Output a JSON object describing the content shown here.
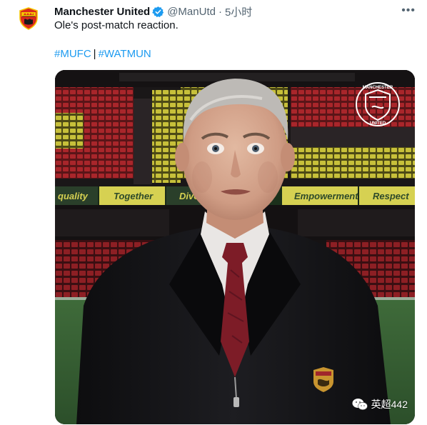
{
  "author": {
    "display_name": "Manchester United",
    "handle": "@ManUtd",
    "time": "5小时",
    "avatar_icon": "manchester-united-crest"
  },
  "tweet": {
    "text": "Ole's post-match reaction.",
    "hashtags": [
      "#MUFC",
      "#WATMUN"
    ],
    "separator": "|"
  },
  "media": {
    "boards": [
      "quality",
      "Together",
      "Dive",
      "Empowerment",
      "Respect"
    ],
    "crest_icon": "manchester-united-crest"
  },
  "watermark": {
    "label": "英超442"
  },
  "colors": {
    "link": "#1d9bf0",
    "verified": "#1d9bf0",
    "muted": "#536471",
    "seat_red": "#a9262b",
    "seat_yellow": "#c7c03a",
    "board_yellow": "#d6d152"
  }
}
